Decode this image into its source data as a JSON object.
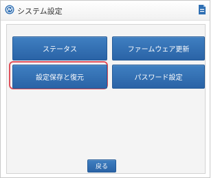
{
  "window": {
    "title": "システム設定",
    "title_icon": "globe-icon",
    "corner_icon": "document-icon"
  },
  "menu": {
    "status_label": "ステータス",
    "firmware_label": "ファームウェア更新",
    "backup_label": "設定保存と復元",
    "password_label": "パスワード設定"
  },
  "footer": {
    "back_label": "戻る"
  },
  "colors": {
    "button": "#2f6fb3",
    "highlight": "#e0505a",
    "panel": "#f4f4f4"
  }
}
